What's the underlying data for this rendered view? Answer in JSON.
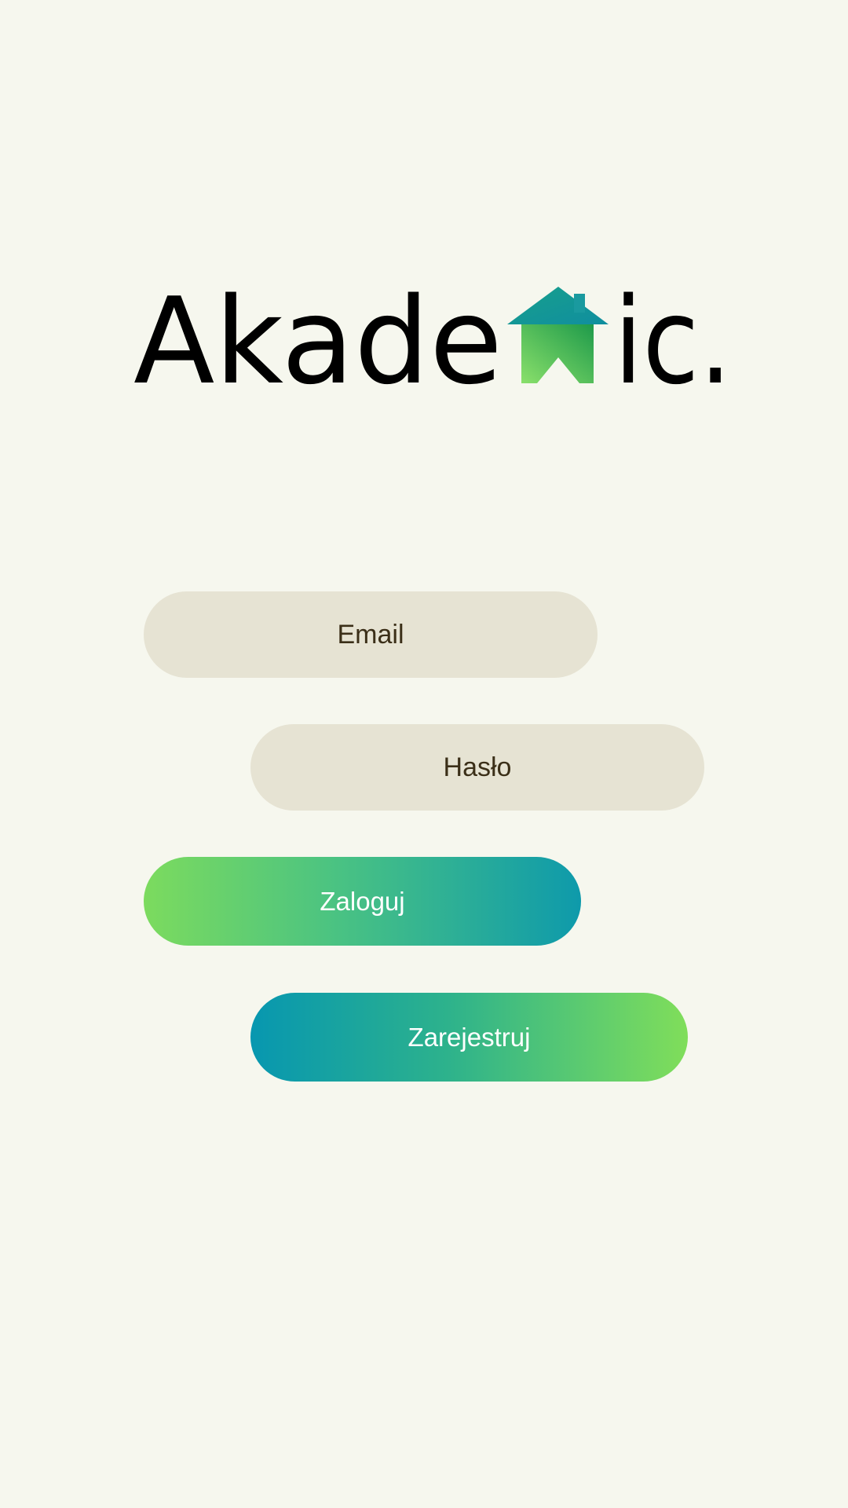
{
  "logo": {
    "text_before": "Akade",
    "text_after": "ic.",
    "house_colors": [
      "#1a9aa2",
      "#34b461",
      "#88e06a"
    ]
  },
  "form": {
    "email_placeholder": "Email",
    "password_placeholder": "Hasło",
    "login_label": "Zaloguj",
    "register_label": "Zarejestruj"
  },
  "colors": {
    "background": "#f6f7ee",
    "field": "#e6e3d3",
    "accent_green": "#7cdb5e",
    "accent_teal": "#0797b0"
  }
}
